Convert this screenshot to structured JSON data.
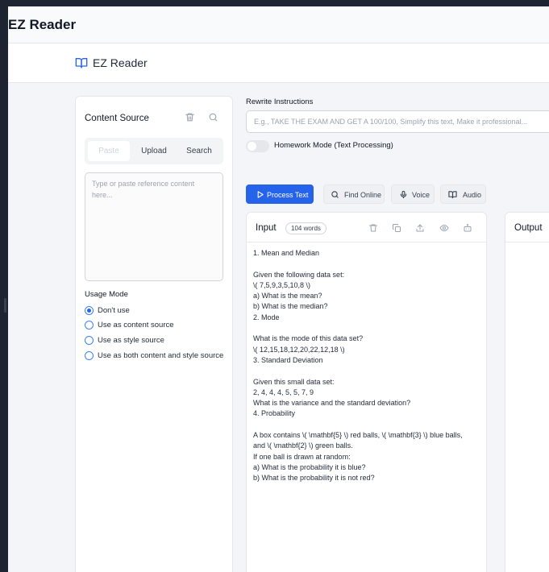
{
  "window": {
    "title": "EZ Reader"
  },
  "header": {
    "app_name": "EZ Reader",
    "logo_icon": "book-open-icon"
  },
  "content_source": {
    "title": "Content Source",
    "tabs": [
      "Paste",
      "Upload",
      "Search"
    ],
    "active_tab": "Paste",
    "textarea_placeholder": "Type or paste reference content here...",
    "usage_mode_label": "Usage Mode",
    "usage_options": [
      {
        "label": "Don't use",
        "checked": true
      },
      {
        "label": "Use as content source",
        "checked": false
      },
      {
        "label": "Use as style source",
        "checked": false
      },
      {
        "label": "Use as both content and style source",
        "checked": false
      }
    ]
  },
  "rewrite": {
    "label": "Rewrite Instructions",
    "placeholder": "E.g., TAKE THE EXAM AND GET A 100/100, Simplify this text, Make it professional...",
    "homework_mode_label": "Homework Mode (Text Processing)",
    "homework_mode_on": false
  },
  "actions": {
    "process_text": "Process Text",
    "find_online": "Find Online",
    "voice": "Voice",
    "audio": "Audio"
  },
  "input_panel": {
    "title": "Input",
    "word_count": "104 words",
    "text": "1. Mean and Median\n\nGiven the following data set:\n\\( 7,5,9,3,5,10,8 \\)\na) What is the mean?\nb) What is the median?\n2. Mode\n\nWhat is the mode of this data set?\n\\( 12,15,18,12,20,22,12,18 \\)\n3. Standard Deviation\n\nGiven this small data set:\n2, 4, 4, 4, 5, 5, 7, 9\nWhat is the variance and the standard deviation?\n4. Probability\n\nA box contains \\( \\mathbf{5} \\) red balls, \\( \\mathbf{3} \\) blue balls,\nand \\( \\mathbf{2} \\) green balls.\nIf one ball is drawn at random:\na) What is the probability it is blue?\nb) What is the probability it is not red?"
  },
  "output_panel": {
    "title": "Output"
  },
  "colors": {
    "primary": "#2563eb",
    "background": "#f3f5f8",
    "border": "#e5e7eb"
  }
}
